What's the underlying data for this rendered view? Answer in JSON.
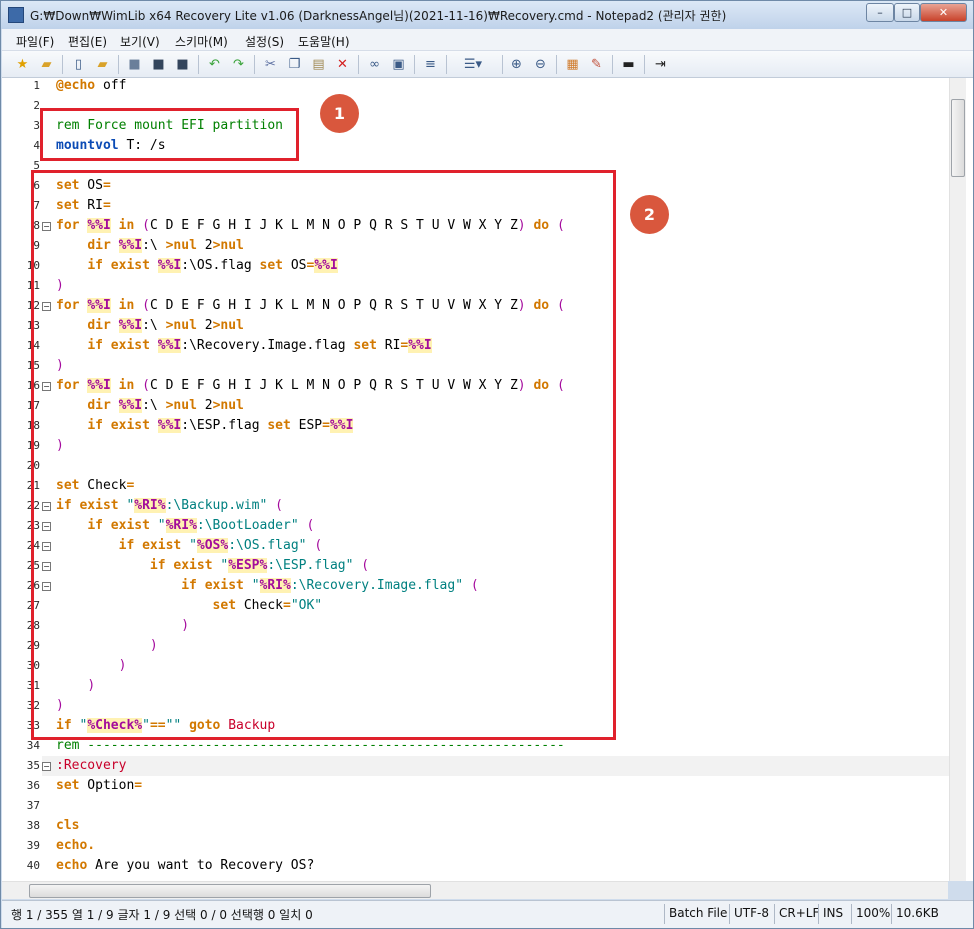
{
  "window": {
    "title": "G:₩Down₩WimLib x64 Recovery Lite v1.06 (DarknessAngel님)(2021-11-16)₩Recovery.cmd - Notepad2 (관리자 권한)",
    "minimize": "–",
    "maximize": "□",
    "close": "✕"
  },
  "menu": [
    "파일(F)",
    "편집(E)",
    "보기(V)",
    "스키마(M)",
    "설정(S)",
    "도움말(H)"
  ],
  "toolbar_icons": [
    "star-icon",
    "folder-open-icon",
    "new-file-icon",
    "open-icon",
    "save-icon",
    "save-as-icon",
    "save-all-icon",
    "undo-icon",
    "redo-icon",
    "cut-icon",
    "copy-icon",
    "paste-icon",
    "delete-icon",
    "find-icon",
    "replace-icon",
    "wrap-icon",
    "list-icon",
    "zoom-in-icon",
    "zoom-out-icon",
    "scheme-icon",
    "color-icon",
    "console-icon",
    "exit-icon"
  ],
  "badges": {
    "one": "1",
    "two": "2"
  },
  "editor": {
    "line_numbers": [
      "1",
      "2",
      "3",
      "4",
      "5",
      "6",
      "7",
      "8",
      "9",
      "10",
      "11",
      "12",
      "13",
      "14",
      "15",
      "16",
      "17",
      "18",
      "19",
      "20",
      "21",
      "22",
      "23",
      "24",
      "25",
      "26",
      "27",
      "28",
      "29",
      "30",
      "31",
      "32",
      "33",
      "34",
      "35",
      "36",
      "37",
      "38",
      "39",
      "40"
    ]
  },
  "status": {
    "position": "행 1 / 355  열 1 / 9  글자 1 / 9  선택 0 / 0  선택행 0  일치 0",
    "type": "Batch File",
    "encoding": "UTF-8",
    "eol": "CR+LF",
    "ins": "INS",
    "zoom": "100%",
    "size": "10.6KB"
  }
}
